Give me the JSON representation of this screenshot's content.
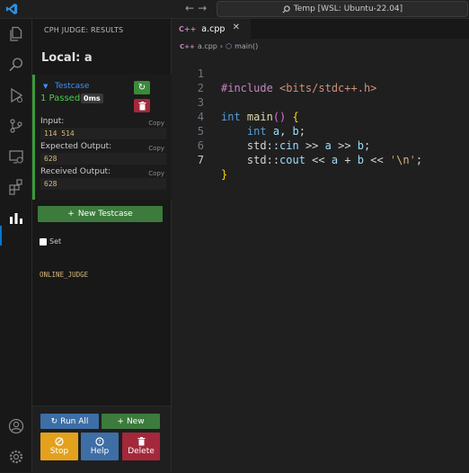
{
  "titlebar": {
    "back_arrow": "←",
    "forward_arrow": "→",
    "command_center": "Temp [WSL: Ubuntu-22.04]",
    "search_icon": "search-icon"
  },
  "activity_bar": {
    "icons": [
      "explorer-icon",
      "search-icon",
      "run-debug-icon",
      "source-control-icon",
      "remote-explorer-icon",
      "extensions-icon",
      "cph-judge-icon",
      "account-icon",
      "settings-gear-icon"
    ],
    "active": "cph-judge-icon"
  },
  "sidebar": {
    "header": "CPH JUDGE: RESULTS",
    "title": "Local: a",
    "testcase": {
      "label": "Testcase",
      "status": "1 Passed",
      "time": "0ms",
      "input_label": "Input:",
      "input_value": "114 514",
      "expected_label": "Expected Output:",
      "expected_value": "628",
      "received_label": "Received Output:",
      "received_value": "628",
      "copy_label": "Copy"
    },
    "new_testcase_label": "New Testcase",
    "set_judge_label": "Set",
    "set_judge_code": "ONLINE_JUDGE",
    "bottom": {
      "run_all": "Run All",
      "new": "New",
      "stop": "Stop",
      "help": "Help",
      "delete": "Delete"
    }
  },
  "editor": {
    "tab_label": "a.cpp",
    "tab_icon": "C++",
    "breadcrumb": [
      "a.cpp",
      "main()"
    ],
    "line_numbers": [
      "1",
      "2",
      "3",
      "4",
      "5",
      "6",
      "7"
    ],
    "lines": {
      "l1_pp": "#include",
      "l1_inc": "<bits/stdc++.h>",
      "l3_kw": "int",
      "l3_fn": "main",
      "l3_rest": "()",
      "l3_brace": "{",
      "l4_kw": "int",
      "l4_a": "a",
      "l4_comma": ", ",
      "l4_b": "b",
      "l4_semi": ";",
      "l5_std": "std",
      "l5_sep": "::",
      "l5_cin": "cin",
      "l5_op1": " >> ",
      "l5_a": "a",
      "l5_op2": " >> ",
      "l5_b": "b",
      "l5_semi": ";",
      "l6_std": "std",
      "l6_sep": "::",
      "l6_cout": "cout",
      "l6_op1": " << ",
      "l6_a": "a",
      "l6_plus": " + ",
      "l6_b": "b",
      "l6_op2": " << ",
      "l6_q1": "'",
      "l6_esc": "\\n",
      "l6_q2": "'",
      "l6_semi": ";",
      "l7_brace": "}"
    }
  },
  "colors": {
    "accent": "#0078d4",
    "passed": "#4ec94e",
    "green_button": "#3c7b3c",
    "blue_button": "#3d6ea5",
    "red_button": "#a4283b",
    "stop_button": "#e3a11d"
  }
}
